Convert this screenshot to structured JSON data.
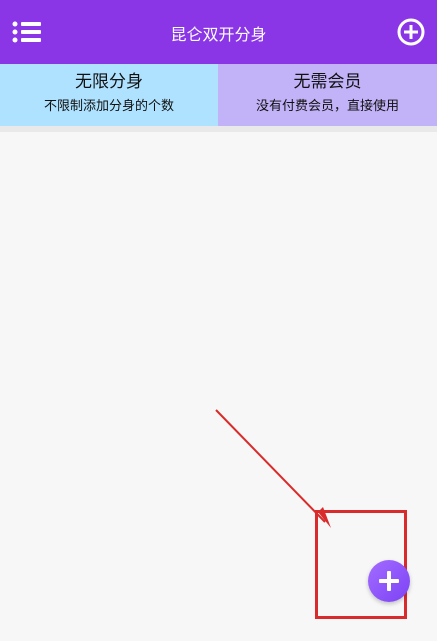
{
  "header": {
    "title": "昆仑双开分身",
    "menu_icon": "list-menu-icon",
    "add_icon": "plus-circle-icon"
  },
  "banner": {
    "left": {
      "title": "无限分身",
      "subtitle": "不限制添加分身的个数"
    },
    "right": {
      "title": "无需会员",
      "subtitle": "没有付费会员，直接使用"
    }
  },
  "colors": {
    "primary": "#8a35e6",
    "left_card": "#aee2ff",
    "right_card": "#c2b2f7",
    "annotation": "#d92b2b",
    "fab": "#8b52f7"
  },
  "fab": {
    "icon": "plus-icon"
  }
}
